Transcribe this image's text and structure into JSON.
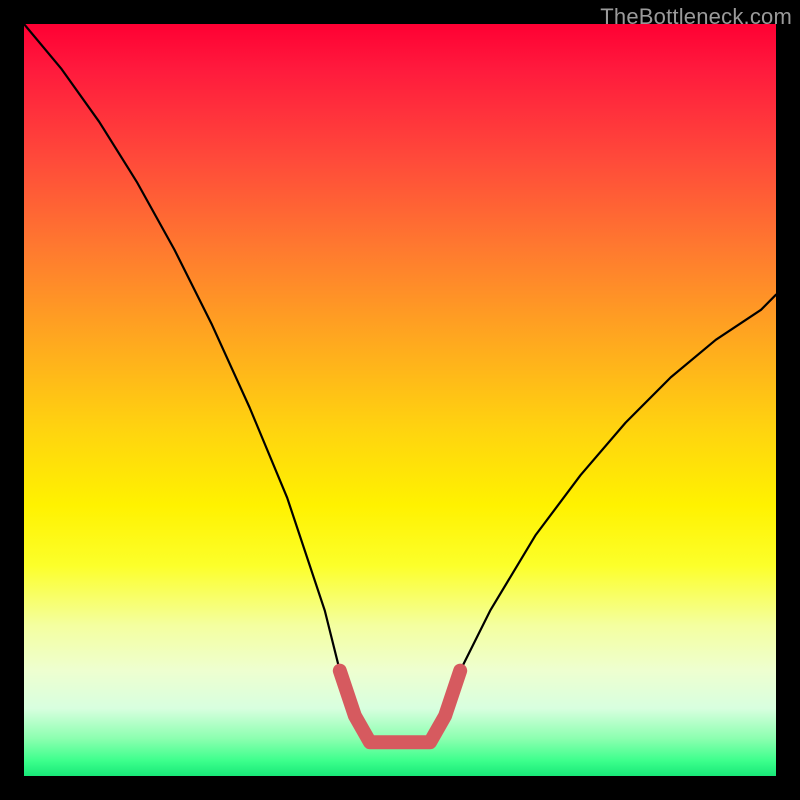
{
  "watermark": "TheBottleneck.com",
  "chart_data": {
    "type": "line",
    "title": "",
    "xlabel": "",
    "ylabel": "",
    "xlim": [
      0,
      100
    ],
    "ylim": [
      0,
      100
    ],
    "grid": false,
    "legend": false,
    "annotations": [],
    "series": [
      {
        "name": "bottleneck-curve",
        "color": "#000000",
        "x": [
          0,
          5,
          10,
          15,
          20,
          25,
          30,
          35,
          40,
          42,
          44,
          46,
          50,
          54,
          56,
          58,
          62,
          68,
          74,
          80,
          86,
          92,
          98,
          100
        ],
        "y": [
          100,
          94,
          87,
          79,
          70,
          60,
          49,
          37,
          22,
          14,
          8,
          4,
          4,
          4,
          8,
          14,
          22,
          32,
          40,
          47,
          53,
          58,
          62,
          64
        ]
      },
      {
        "name": "optimal-range-highlight",
        "color": "#d65a5f",
        "x": [
          42,
          44,
          46,
          50,
          54,
          56,
          58
        ],
        "y": [
          14,
          8,
          4.5,
          4.5,
          4.5,
          8,
          14
        ]
      }
    ],
    "background_gradient_stops": [
      {
        "pos": 0,
        "color": "#ff0033"
      },
      {
        "pos": 18,
        "color": "#ff4a3a"
      },
      {
        "pos": 42,
        "color": "#ffa81f"
      },
      {
        "pos": 64,
        "color": "#fff200"
      },
      {
        "pos": 86,
        "color": "#eeffd0"
      },
      {
        "pos": 100,
        "color": "#18e878"
      }
    ]
  }
}
